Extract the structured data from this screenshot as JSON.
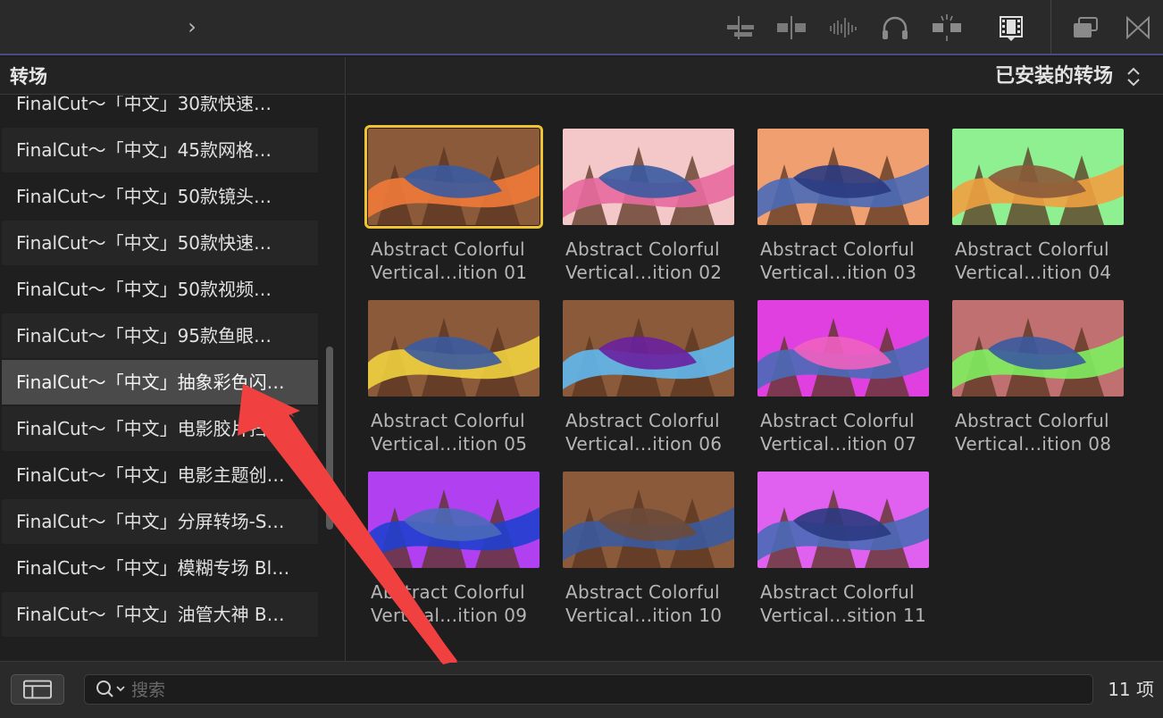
{
  "toolbar": {
    "icons": [
      "chevron-right-icon",
      "connect-clips-icon",
      "split-clip-icon",
      "audio-waveform-icon",
      "headphones-icon",
      "effects-light-icon",
      "filmstrip-icon",
      "window-layout-icon",
      "transitions-browser-icon"
    ],
    "chevron": "›"
  },
  "sidebar": {
    "title": "转场",
    "items": [
      {
        "label": "FinalCut～「中文」30款快速…"
      },
      {
        "label": "FinalCut～「中文」45款网格…"
      },
      {
        "label": "FinalCut～「中文」50款镜头…"
      },
      {
        "label": "FinalCut～「中文」50款快速…"
      },
      {
        "label": "FinalCut～「中文」50款视频…"
      },
      {
        "label": "FinalCut～「中文」95款鱼眼…"
      },
      {
        "label": "FinalCut～「中文」抽象彩色闪…"
      },
      {
        "label": "FinalCut～「中文」电影胶片扫…"
      },
      {
        "label": "FinalCut～「中文」电影主题创…"
      },
      {
        "label": "FinalCut～「中文」分屏转场-S…"
      },
      {
        "label": "FinalCut～「中文」模糊专场 Bl…"
      },
      {
        "label": "FinalCut～「中文」油管大神 B…"
      }
    ],
    "selected_index": 6
  },
  "content": {
    "filter_label": "已安装的转场",
    "tiles": [
      {
        "line1": "Abstract Colorful",
        "line2": "Vertical...ition 01",
        "bg": "#8a5a3a",
        "accent": "#f07a3a",
        "accent2": "#3a5aa0"
      },
      {
        "line1": "Abstract Colorful",
        "line2": "Vertical...ition 02",
        "bg": "#f4c8c8",
        "accent": "#e86aa0",
        "accent2": "#3a5aa0"
      },
      {
        "line1": "Abstract Colorful",
        "line2": "Vertical...ition 03",
        "bg": "#f0a070",
        "accent": "#4a6ab8",
        "accent2": "#2a3a80"
      },
      {
        "line1": "Abstract Colorful",
        "line2": "Vertical...ition 04",
        "bg": "#8ef090",
        "accent": "#f0a040",
        "accent2": "#8a5a3a"
      },
      {
        "line1": "Abstract Colorful",
        "line2": "Vertical...ition 05",
        "bg": "#8a5a3a",
        "accent": "#f0d040",
        "accent2": "#3a5aa0"
      },
      {
        "line1": "Abstract Colorful",
        "line2": "Vertical...ition 06",
        "bg": "#8a5a3a",
        "accent": "#60b8f0",
        "accent2": "#6a20a0"
      },
      {
        "line1": "Abstract Colorful",
        "line2": "Vertical...ition 07",
        "bg": "#e040e0",
        "accent": "#4a6ab8",
        "accent2": "#f060c0"
      },
      {
        "line1": "Abstract Colorful",
        "line2": "Vertical...ition 08",
        "bg": "#c07070",
        "accent": "#80f060",
        "accent2": "#3a5aa0"
      },
      {
        "line1": "Abstract Colorful",
        "line2": "Vertical...ition 09",
        "bg": "#b040f0",
        "accent": "#2040d0",
        "accent2": "#4a6ab8"
      },
      {
        "line1": "Abstract Colorful",
        "line2": "Vertical...ition 10",
        "bg": "#8a5a3a",
        "accent": "#3a5aa0",
        "accent2": "#6a4a3a"
      },
      {
        "line1": "Abstract Colorful",
        "line2": "Vertical...sition 11",
        "bg": "#e060f0",
        "accent": "#4a6ab8",
        "accent2": "#2a3a80"
      }
    ],
    "selected_index": 0
  },
  "bottom": {
    "search_placeholder": "搜索",
    "count": "11 项"
  },
  "colors": {
    "selection_outline": "#f2c230",
    "annotation_arrow": "#f04040"
  }
}
